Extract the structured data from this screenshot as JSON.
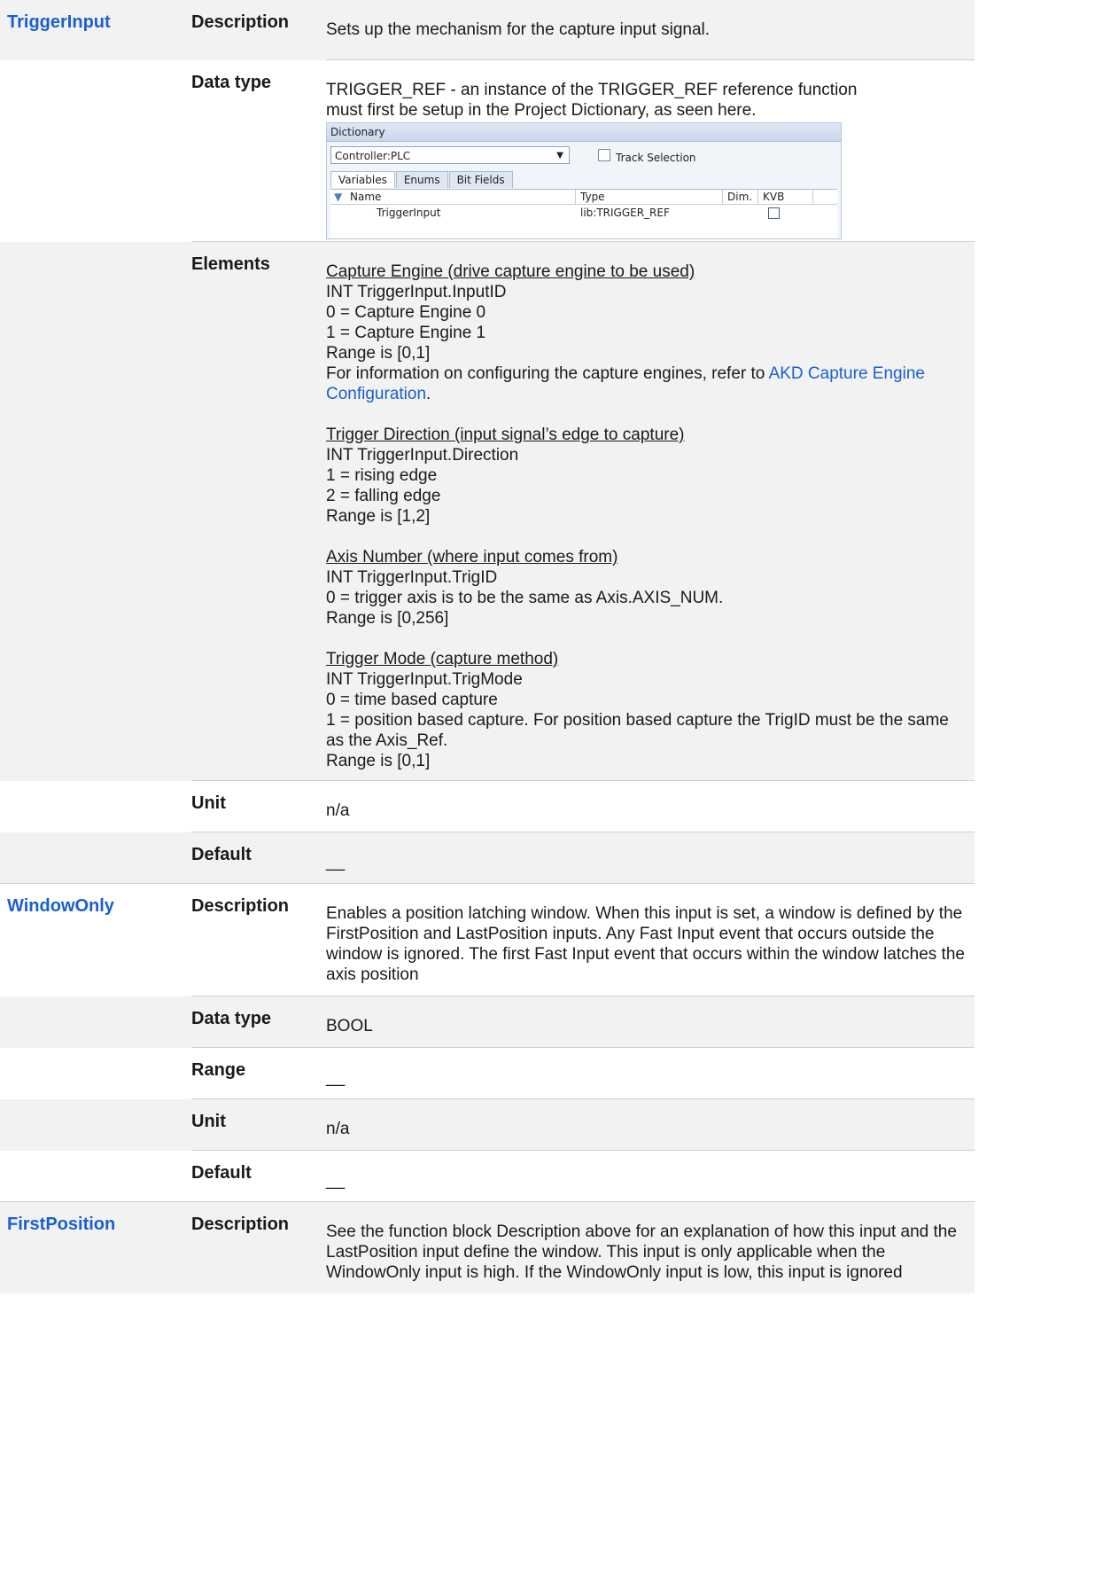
{
  "labels": {
    "description": "Description",
    "data_type": "Data type",
    "elements": "Elements",
    "unit": "Unit",
    "default": "Default",
    "range": "Range"
  },
  "trigger_input": {
    "name": "TriggerInput",
    "description": "Sets up the mechanism for the capture input signal.",
    "data_type_line1": "TRIGGER_REF - an instance of the TRIGGER_REF reference function",
    "data_type_line2": "must first be setup in the Project Dictionary, as seen here.",
    "dictionary": {
      "title": "Dictionary",
      "controller": "Controller:PLC",
      "track_selection": "Track Selection",
      "tabs": [
        "Variables",
        "Enums",
        "Bit Fields"
      ],
      "columns": [
        "Name",
        "Type",
        "Dim.",
        "KVB"
      ],
      "row": {
        "name": "TriggerInput",
        "type": "lib:TRIGGER_REF"
      }
    },
    "elements": {
      "capture_engine": {
        "heading": "Capture Engine (drive capture engine to be used)",
        "lines": [
          "INT TriggerInput.InputID",
          "0 = Capture Engine 0",
          "1 = Capture Engine 1",
          "Range is [0,1]"
        ],
        "info_prefix": "For information on configuring the capture engines, refer to ",
        "info_link": "AKD Capture Engine Configuration",
        "info_suffix": "."
      },
      "trigger_direction": {
        "heading": "Trigger Direction (input signal’s edge to capture)",
        "lines": [
          "INT TriggerInput.Direction",
          "1 = rising edge",
          "2 = falling edge",
          "Range is [1,2]"
        ]
      },
      "axis_number": {
        "heading": "Axis Number (where input comes from)",
        "lines": [
          "INT TriggerInput.TrigID",
          "0 = trigger axis is to be the same as Axis.AXIS_NUM.",
          "Range is [0,256]"
        ]
      },
      "trigger_mode": {
        "heading": "Trigger Mode (capture method)",
        "lines": [
          "INT TriggerInput.TrigMode",
          "0 = time based capture",
          "1 = position based capture. For position based capture the TrigID must be the same as the Axis_Ref.",
          "Range is [0,1]"
        ]
      }
    },
    "unit": "n/a",
    "default": "__"
  },
  "window_only": {
    "name": "WindowOnly",
    "description": "Enables a position latching window. When this input is set, a window is defined by the FirstPosition and LastPosition inputs. Any Fast Input event that occurs outside the window is ignored. The first Fast Input event that occurs within the window latches the axis position",
    "data_type": "BOOL",
    "range": "__",
    "unit": "n/a",
    "default": "__"
  },
  "first_position": {
    "name": "FirstPosition",
    "description": "See the function block Description above for an explanation of how this input and the LastPosition input define the window. This input is only applicable when the WindowOnly input is high. If the WindowOnly input is low, this input is ignored"
  }
}
